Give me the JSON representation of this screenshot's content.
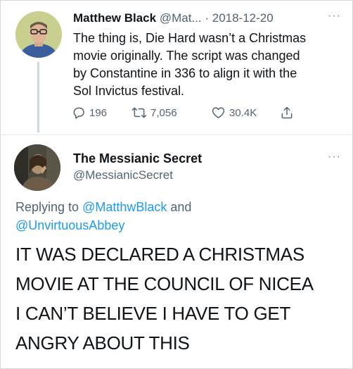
{
  "tweet1": {
    "name": "Matthew Black",
    "handle": "@Mat...",
    "separator": "·",
    "date": "2018-12-20",
    "more": "···",
    "lines": [
      "The thing is, Die Hard wasn’t a Christmas",
      "movie originally. The script was changed",
      "by Constantine in 336 to align it with the",
      "Sol Invictus festival."
    ],
    "actions": {
      "replies": "196",
      "retweets": "7,056",
      "likes": "30.4K"
    },
    "icons": {
      "reply": "comment-icon",
      "retweet": "retweet-icon",
      "like": "heart-icon",
      "share": "share-icon"
    }
  },
  "tweet2": {
    "name": "The Messianic Secret",
    "handle": "@MessianicSecret",
    "more": "···",
    "replying_prefix": "Replying to ",
    "mention_1": "@MatthwBlack",
    "replying_and": " and",
    "mention_2": "@UnvirtuousAbbey",
    "body_lines": [
      "IT WAS DECLARED A CHRISTMAS",
      "MOVIE AT THE COUNCIL OF NICEA",
      "I CAN’T BELIEVE I HAVE TO GET",
      "ANGRY ABOUT THIS"
    ]
  },
  "colors": {
    "text": "#0f1419",
    "secondary": "#536471",
    "link": "#1d9bf0",
    "thread_line": "#cfd9de"
  }
}
